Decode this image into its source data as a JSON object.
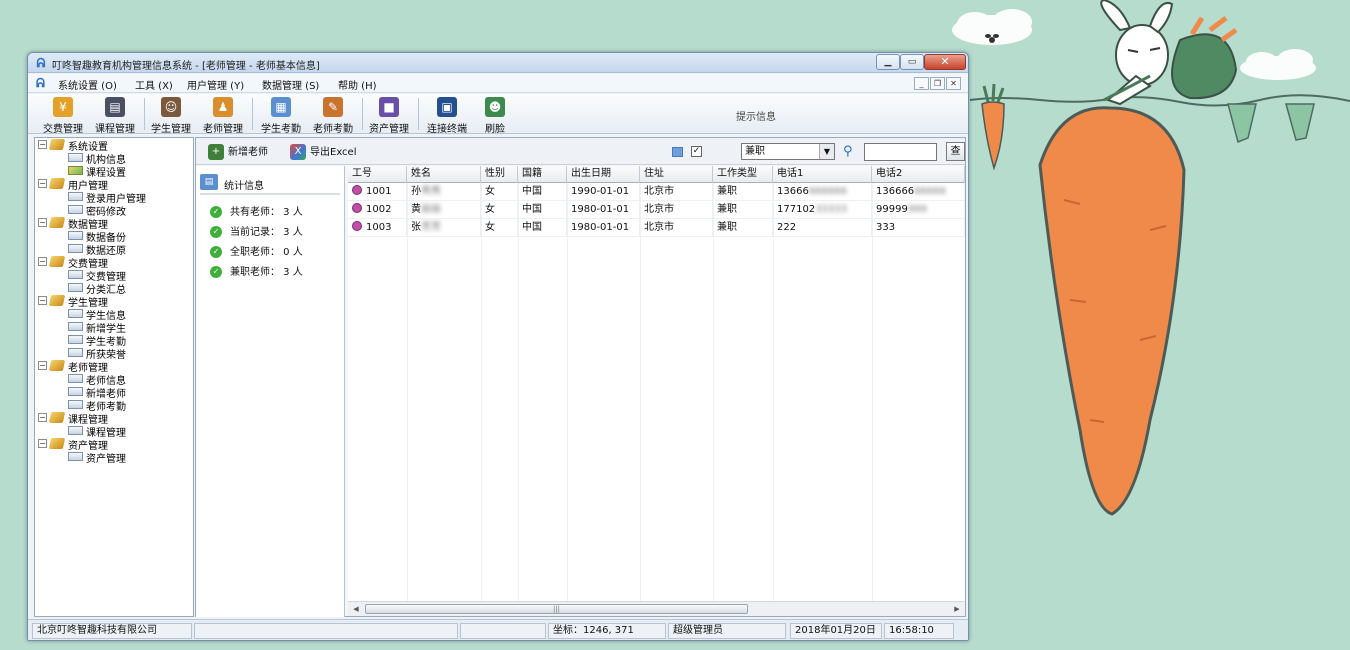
{
  "window": {
    "title": "叮咚智趣教育机构管理信息系统 - [老师管理 - 老师基本信息]",
    "icon": "app-logo-icon"
  },
  "menubar": {
    "items": [
      "系统设置 (O)",
      "工具 (X)",
      "用户管理 (Y)",
      "数据管理 (S)",
      "帮助 (H)"
    ]
  },
  "toolbar": {
    "buttons": [
      {
        "label": "交费管理",
        "icon": "cash-register-icon"
      },
      {
        "label": "课程管理",
        "icon": "book-icon"
      },
      {
        "label": "学生管理",
        "icon": "student-icon"
      },
      {
        "label": "老师管理",
        "icon": "teacher-icon"
      },
      {
        "label": "学生考勤",
        "icon": "chart-icon"
      },
      {
        "label": "老师考勤",
        "icon": "attendance-icon"
      },
      {
        "label": "资产管理",
        "icon": "cube-icon"
      },
      {
        "label": "连接终端",
        "icon": "terminal-icon"
      },
      {
        "label": "刷脸",
        "icon": "face-scan-icon"
      }
    ],
    "hint": "提示信息"
  },
  "tree": [
    {
      "label": "系统设置",
      "children": [
        "机构信息",
        "课程设置"
      ]
    },
    {
      "label": "用户管理",
      "children": [
        "登录用户管理",
        "密码修改"
      ]
    },
    {
      "label": "数据管理",
      "children": [
        "数据备份",
        "数据还原"
      ]
    },
    {
      "label": "交费管理",
      "children": [
        "交费管理",
        "分类汇总"
      ]
    },
    {
      "label": "学生管理",
      "children": [
        "学生信息",
        "新增学生",
        "学生考勤",
        "所获荣誉"
      ]
    },
    {
      "label": "老师管理",
      "children": [
        "老师信息",
        "新增老师",
        "老师考勤"
      ]
    },
    {
      "label": "课程管理",
      "children": [
        "课程管理"
      ]
    },
    {
      "label": "资产管理",
      "children": [
        "资产管理"
      ]
    }
  ],
  "subbar": {
    "add_teacher": "新增老师",
    "export_excel": "导出Excel",
    "checkbox_mark": "✓",
    "filter_value": "兼职",
    "search_button": "查"
  },
  "stats": {
    "title": "统计信息",
    "rows": [
      "共有老师： 3 人",
      "当前记录： 3 人",
      "全职老师： 0 人",
      "兼职老师： 3 人"
    ]
  },
  "grid": {
    "columns": [
      "工号",
      "姓名",
      "性别",
      "国籍",
      "出生日期",
      "住址",
      "工作类型",
      "电话1",
      "电话2"
    ],
    "rows": [
      {
        "id": "1001",
        "name": "孙",
        "name_hidden": "秀秀",
        "gender": "女",
        "nationality": "中国",
        "birth": "1990-01-01",
        "address": "北京市",
        "type": "兼职",
        "phone1": "13666",
        "phone1_hidden": "666666",
        "phone2": "136666",
        "phone2_hidden": "66666"
      },
      {
        "id": "1002",
        "name": "黄",
        "name_hidden": "丽丽",
        "gender": "女",
        "nationality": "中国",
        "birth": "1980-01-01",
        "address": "北京市",
        "type": "兼职",
        "phone1": "177102",
        "phone1_hidden": "33333",
        "phone2": "99999",
        "phone2_hidden": "999"
      },
      {
        "id": "1003",
        "name": "张",
        "name_hidden": "芳芳",
        "gender": "女",
        "nationality": "中国",
        "birth": "1980-01-01",
        "address": "北京市",
        "type": "兼职",
        "phone1": "222",
        "phone1_hidden": "",
        "phone2": "333",
        "phone2_hidden": ""
      }
    ]
  },
  "statusbar": {
    "company": "北京叮咚智趣科技有限公司",
    "coords": "坐标：1246, 371",
    "role": "超级管理员",
    "date": "2018年01月20日",
    "time": "16:58:10"
  },
  "colors": {
    "wallpaper": "#b6dccd",
    "carrot": "#f08a4b",
    "accent": "#2e6fc7"
  }
}
